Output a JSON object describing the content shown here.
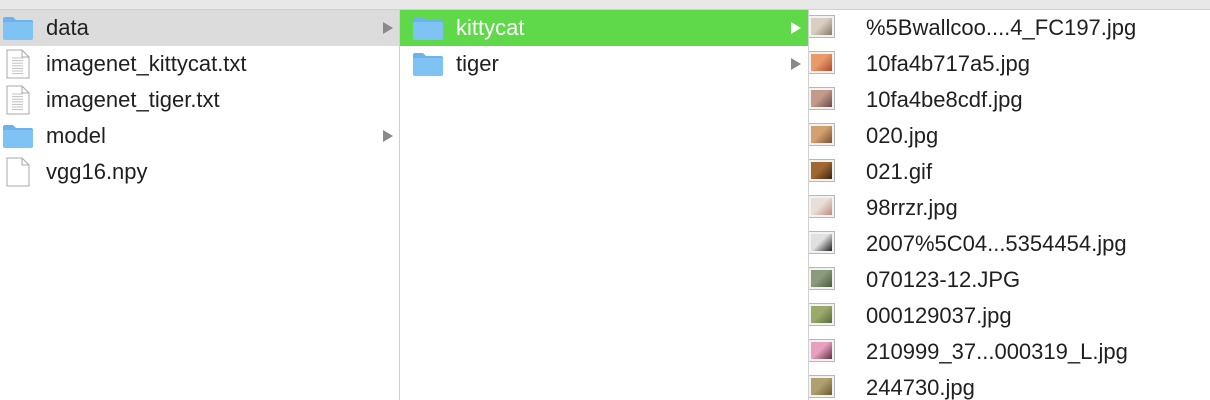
{
  "columns": {
    "root": [
      {
        "name": "data",
        "type": "folder",
        "expandable": true,
        "state": "selected"
      },
      {
        "name": "imagenet_kittycat.txt",
        "type": "text-file",
        "expandable": false,
        "state": "none"
      },
      {
        "name": "imagenet_tiger.txt",
        "type": "text-file",
        "expandable": false,
        "state": "none"
      },
      {
        "name": "model",
        "type": "folder",
        "expandable": true,
        "state": "none"
      },
      {
        "name": "vgg16.npy",
        "type": "file",
        "expandable": false,
        "state": "none"
      }
    ],
    "data": [
      {
        "name": "kittycat",
        "type": "folder",
        "expandable": true,
        "state": "active"
      },
      {
        "name": "tiger",
        "type": "folder",
        "expandable": true,
        "state": "none"
      }
    ],
    "kittycat": [
      {
        "name": "%5Bwallcoo....4_FC197.jpg",
        "type": "image",
        "thumb_colors": [
          "#d8cfc0",
          "#8a7a66"
        ]
      },
      {
        "name": "10fa4b717a5.jpg",
        "type": "image",
        "thumb_colors": [
          "#e89a6a",
          "#b04a2a"
        ]
      },
      {
        "name": "10fa4be8cdf.jpg",
        "type": "image",
        "thumb_colors": [
          "#c49a8a",
          "#6a4a4a"
        ]
      },
      {
        "name": "020.jpg",
        "type": "image",
        "thumb_colors": [
          "#d4a070",
          "#7a5030"
        ]
      },
      {
        "name": "021.gif",
        "type": "image",
        "thumb_colors": [
          "#a06830",
          "#3a2410"
        ]
      },
      {
        "name": "98rrzr.jpg",
        "type": "image",
        "thumb_colors": [
          "#e8e0d8",
          "#c08a80"
        ]
      },
      {
        "name": "2007%5C04...5354454.jpg",
        "type": "image",
        "thumb_colors": [
          "#e0e0e0",
          "#202020"
        ]
      },
      {
        "name": "070123-12.JPG",
        "type": "image",
        "thumb_colors": [
          "#8a9a7a",
          "#4a5a3a"
        ]
      },
      {
        "name": "000129037.jpg",
        "type": "image",
        "thumb_colors": [
          "#9aaa6a",
          "#5a6a3a"
        ]
      },
      {
        "name": "210999_37...000319_L.jpg",
        "type": "image",
        "thumb_colors": [
          "#e8a0c0",
          "#603040"
        ]
      },
      {
        "name": "244730.jpg",
        "type": "image",
        "thumb_colors": [
          "#b0a070",
          "#6a5a30"
        ]
      }
    ]
  },
  "colors": {
    "selected_gray": "#dcdcdc",
    "selected_green": "#5fd84a",
    "folder_blue": "#7ec3f4"
  }
}
